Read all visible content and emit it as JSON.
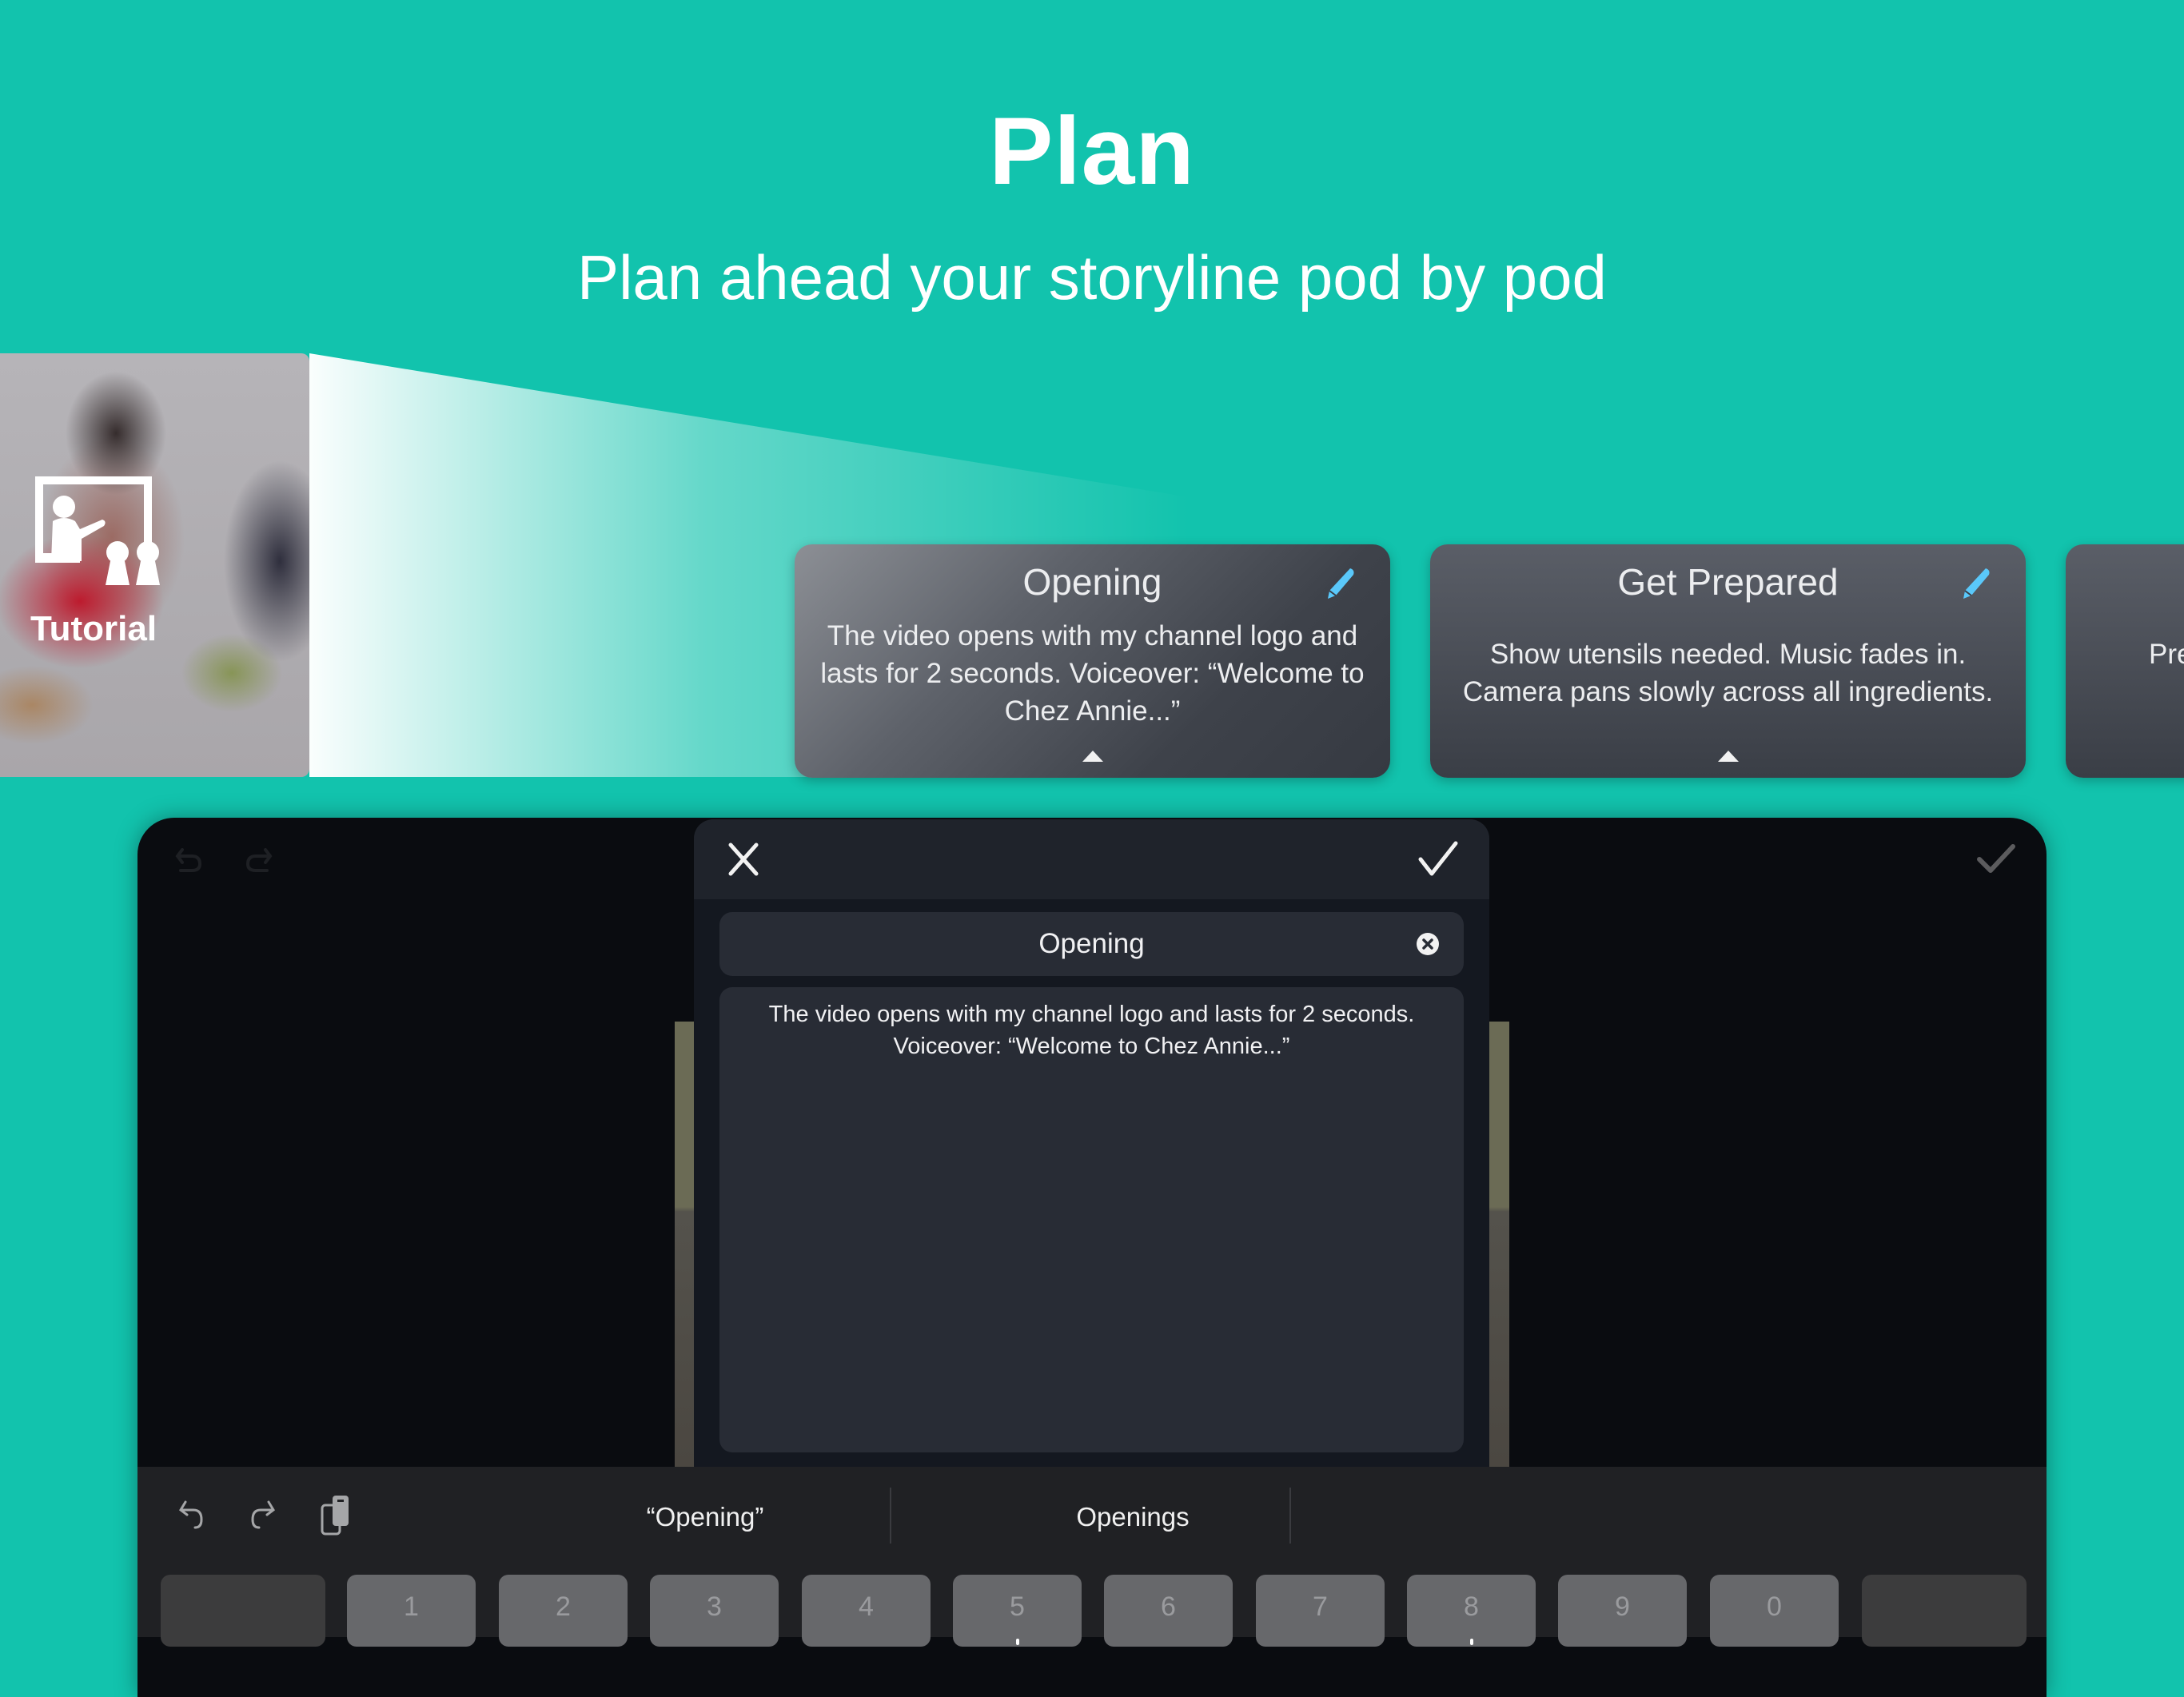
{
  "hero": {
    "title": "Plan",
    "subtitle": "Plan ahead your storyline pod by pod"
  },
  "thumbnail": {
    "label": "Tutorial",
    "icon": "classroom-presentation-icon"
  },
  "pods": [
    {
      "title": "Opening",
      "description": "The video opens with my channel logo and lasts for 2 seconds. Voiceover: “Welcome to Chez Annie...”",
      "edit_icon": "pencil-icon",
      "state": "active"
    },
    {
      "title": "Get Prepared",
      "description": "Show utensils needed. Music fades in. Camera pans slowly across all ingredients.",
      "edit_icon": "pencil-icon",
      "state": "normal"
    },
    {
      "title": "",
      "description": "Pre",
      "state": "partial"
    }
  ],
  "editor": {
    "toolbar": {
      "undo_icon": "undo-icon",
      "redo_icon": "redo-icon",
      "done_icon": "checkmark-icon"
    },
    "modal": {
      "close_icon": "close-icon",
      "confirm_icon": "checkmark-icon",
      "title_value": "Opening",
      "title_clear_icon": "clear-circle-icon",
      "description_value": "The video opens with my channel logo and lasts for 2 seconds. Voiceover: “Welcome to Chez Annie...”"
    }
  },
  "keyboard": {
    "shortcuts": [
      "undo-icon",
      "redo-icon",
      "paste-icon"
    ],
    "suggestions": [
      "“Opening”",
      "Openings",
      ""
    ],
    "number_keys": [
      "1",
      "2",
      "3",
      "4",
      "5",
      "6",
      "7",
      "8",
      "9",
      "0"
    ]
  },
  "colors": {
    "background": "#12c3ad",
    "pencil": "#5ac8fa",
    "card_dark": "#3a3e46"
  }
}
